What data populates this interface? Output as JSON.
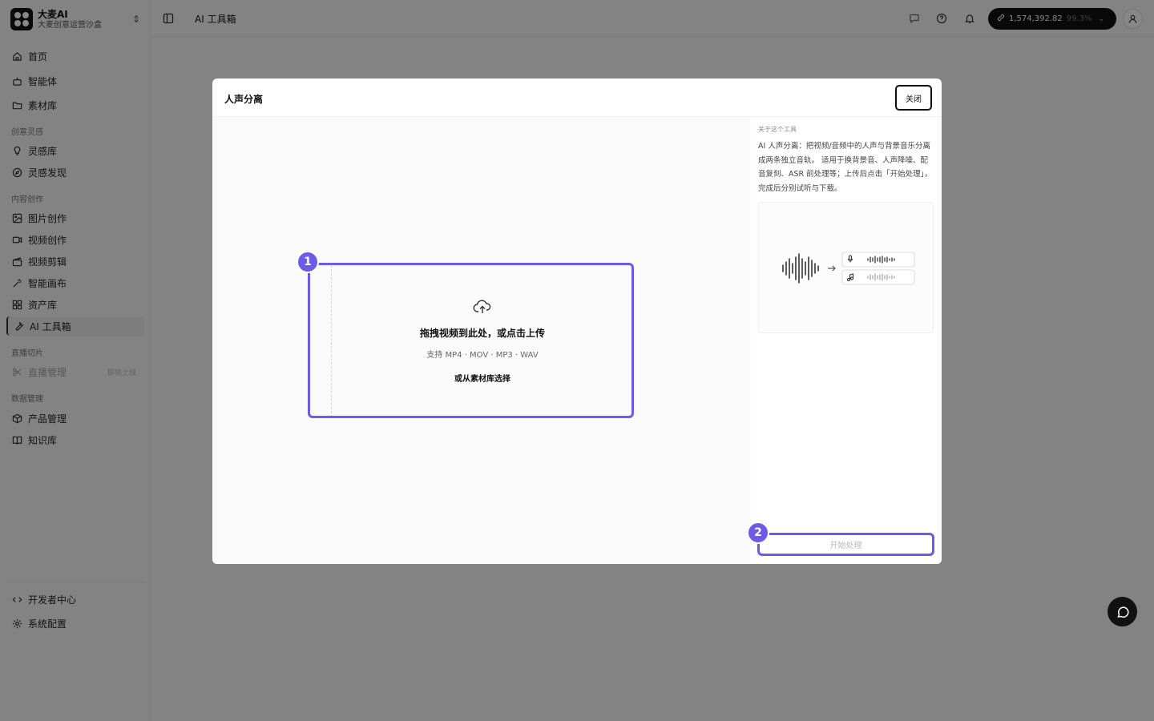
{
  "brand": {
    "name": "大麦AI",
    "subtitle": "大麦创意运营沙盒"
  },
  "sidebar": {
    "items_top": [
      {
        "label": "首页",
        "icon": "home-icon"
      },
      {
        "label": "智能体",
        "icon": "robot-icon"
      },
      {
        "label": "素材库",
        "icon": "folder-icon"
      }
    ],
    "group_inspiration": "创意灵感",
    "inspiration_items": [
      {
        "label": "灵感库",
        "icon": "bulb-icon"
      },
      {
        "label": "灵感发现",
        "icon": "compass-icon"
      }
    ],
    "group_content": "内容创作",
    "content_items": [
      {
        "label": "图片创作",
        "icon": "image-icon"
      },
      {
        "label": "视频创作",
        "icon": "video-icon"
      },
      {
        "label": "视频剪辑",
        "icon": "clapper-icon"
      },
      {
        "label": "智能画布",
        "icon": "wand-icon"
      },
      {
        "label": "资产库",
        "icon": "grid-icon"
      },
      {
        "label": "AI 工具箱",
        "icon": "wrench-icon",
        "active": true
      }
    ],
    "group_live": "直播切片",
    "live_items": [
      {
        "label": "直播管理",
        "icon": "scissors-icon",
        "tag": "即将上线",
        "disabled": true
      }
    ],
    "group_data": "数据管理",
    "data_items": [
      {
        "label": "产品管理",
        "icon": "box-icon"
      },
      {
        "label": "知识库",
        "icon": "book-icon"
      }
    ],
    "bottom_items": [
      {
        "label": "开发者中心",
        "icon": "code-icon"
      },
      {
        "label": "系统配置",
        "icon": "gear-icon"
      }
    ]
  },
  "topbar": {
    "breadcrumb": "AI 工具箱",
    "credits": "1,574,392.82",
    "credits_pct": "99.3%"
  },
  "modal": {
    "title": "人声分离",
    "close_label": "关闭",
    "step1": "1",
    "step2": "2",
    "drop_title": "拖拽视频到此处，或点击上传",
    "drop_formats": "支持 MP4 · MOV · MP3 · WAV",
    "drop_library": "或从素材库选择",
    "about_label": "关于这个工具",
    "about_desc": "AI 人声分离：把视频/音频中的人声与背景音乐分离成两条独立音轨。 适用于换背景音、人声降噪、配音复刻、ASR 前处理等；上传后点击「开始处理」，完成后分别试听与下载。",
    "start_label": "开始处理"
  },
  "colors": {
    "accent": "#6b5be6",
    "dark": "#111111"
  }
}
